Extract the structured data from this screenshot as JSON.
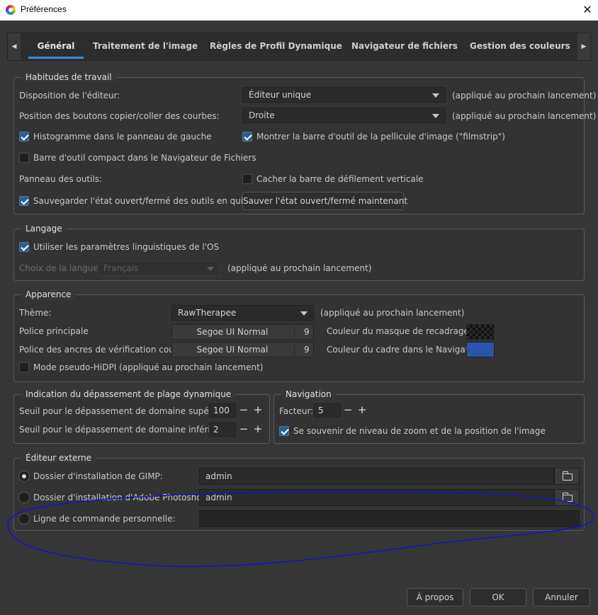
{
  "window": {
    "title": "Préférences",
    "close_glyph": "✕",
    "icon": "rawtherapee-logo-icon"
  },
  "tabs": [
    {
      "label": "Général",
      "active": true
    },
    {
      "label": "Traitement de l'image"
    },
    {
      "label": "Règles de Profil Dynamique"
    },
    {
      "label": "Navigateur de fichiers"
    },
    {
      "label": "Gestion des couleurs"
    }
  ],
  "tab_scroll": {
    "left": "◀",
    "right": "▶"
  },
  "work": {
    "title": "Habitudes de travail",
    "editor_layout_label": "Disposition de l'éditeur:",
    "editor_layout_value": "Éditeur unique",
    "editor_layout_note": "(appliqué au prochain lancement)",
    "curve_buttons_label": "Position des boutons copier/coller des courbes:",
    "curve_buttons_value": "Droite",
    "curve_buttons_note": "(appliqué au prochain lancement)",
    "histogram_left": "Histogramme dans le panneau de gauche",
    "filmstrip": "Montrer la barre d'outil de la pellicule d'image (\"filmstrip\")",
    "compact_toolbar": "Barre d'outil compact dans le Navigateur de Fichiers",
    "tools_panel_label": "Panneau des outils:",
    "hide_scrollbar": "Cacher la barre de défilement verticale",
    "save_state_on_exit": "Sauvegarder l'état ouvert/fermé des outils en quittant",
    "save_state_now": "Sauver l'état ouvert/fermé maintenant"
  },
  "language": {
    "title": "Langage",
    "use_os": "Utiliser les paramètres linguistiques de l'OS",
    "choice_label": "Choix de la langue:",
    "choice_value": "Français",
    "note": "(appliqué au prochain lancement)"
  },
  "appearance": {
    "title": "Apparence",
    "theme_label": "Thème:",
    "theme_value": "RawTherapee",
    "theme_note": "(appliqué au prochain lancement)",
    "main_font_label": "Police principale",
    "main_font_name": "Segoe UI Normal",
    "main_font_size": "9",
    "anchor_font_label": "Police des ancres de vérification couleur:",
    "anchor_font_name": "Segoe UI Normal",
    "anchor_font_size": "9",
    "crop_mask_label": "Couleur du masque de recadrage:",
    "nav_frame_label": "Couleur du cadre dans le Navigateur:",
    "nav_frame_color": "#2a55a8",
    "hidpi": "Mode pseudo-HiDPI (appliqué au prochain lancement)"
  },
  "clipping": {
    "title": "Indication du dépassement de plage dynamique",
    "upper_label": "Seuil pour le dépassement de domaine supérieur:",
    "upper_value": "100",
    "lower_label": "Seuil pour le dépassement de domaine inférieur:",
    "lower_value": "2",
    "minus": "−",
    "plus": "+"
  },
  "navigation": {
    "title": "Navigation",
    "factor_label": "Facteur:",
    "factor_value": "5",
    "remember_zoom": "Se souvenir de niveau de zoom et de la position de l'image"
  },
  "external": {
    "title": "Éditeur externe",
    "gimp_label": "Dossier d'installation de GIMP:",
    "gimp_path": "admin",
    "ps_label": "Dossier d'installation d'Adobe Photoshop:",
    "ps_path": "admin",
    "custom_label": "Ligne de commande personnelle:",
    "custom_value": ""
  },
  "annotation": {
    "color": "#1414c8",
    "shape": "hand-drawn-ellipse"
  },
  "footer": {
    "about": "À propos",
    "ok": "OK",
    "cancel": "Annuler"
  }
}
